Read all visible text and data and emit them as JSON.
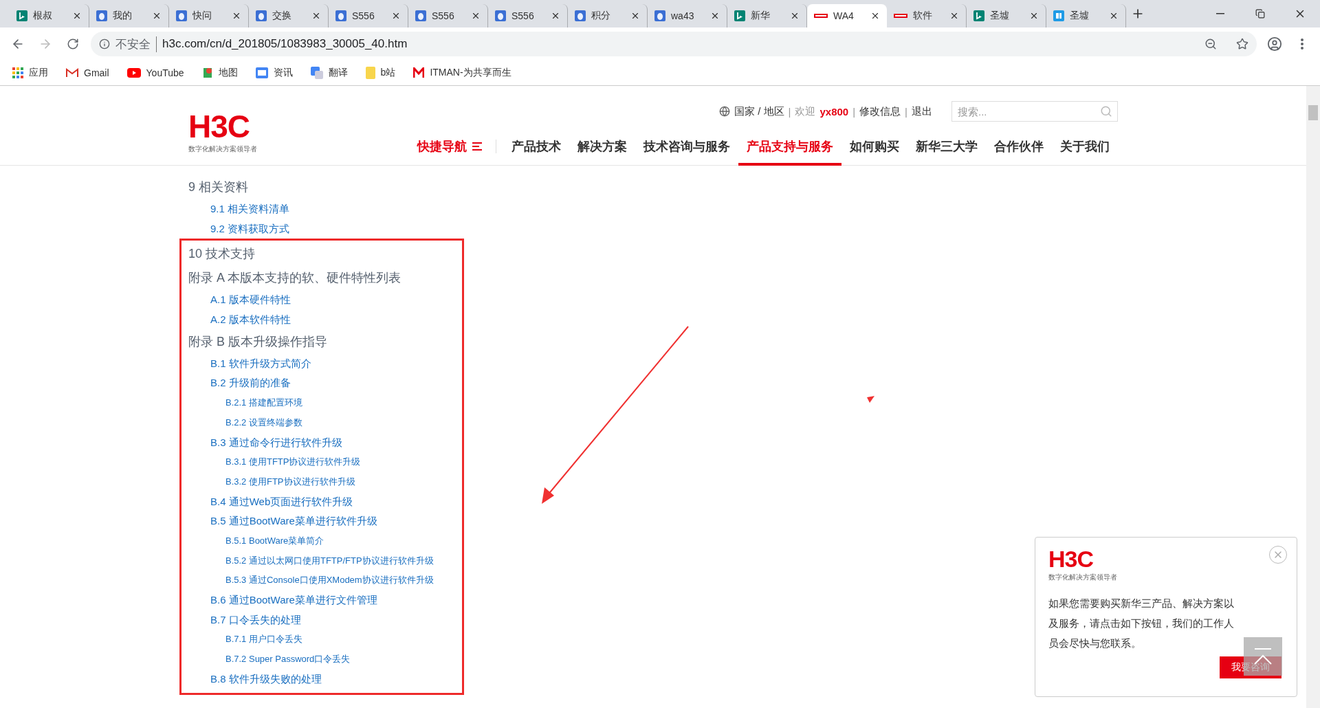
{
  "browser": {
    "tabs": [
      {
        "label": "根叔",
        "kind": "bing",
        "selected": false
      },
      {
        "label": "我的",
        "kind": "drop",
        "selected": false
      },
      {
        "label": "快问",
        "kind": "drop",
        "selected": false
      },
      {
        "label": "交换",
        "kind": "drop",
        "selected": false
      },
      {
        "label": "S556",
        "kind": "drop",
        "selected": false
      },
      {
        "label": "S556",
        "kind": "drop",
        "selected": false
      },
      {
        "label": "S556",
        "kind": "drop",
        "selected": false
      },
      {
        "label": "积分",
        "kind": "drop",
        "selected": false
      },
      {
        "label": "wa43",
        "kind": "drop",
        "selected": false
      },
      {
        "label": "新华",
        "kind": "bing",
        "selected": false
      },
      {
        "label": "WA4",
        "kind": "h3c",
        "selected": true
      },
      {
        "label": "软件",
        "kind": "h3c",
        "selected": false
      },
      {
        "label": "圣墟",
        "kind": "bing",
        "selected": false
      },
      {
        "label": "圣墟",
        "kind": "book",
        "selected": false
      }
    ],
    "forward_disabled": true,
    "security_label": "不安全",
    "url": "h3c.com/cn/d_201805/1083983_30005_40.htm",
    "bookmarks": [
      {
        "label": "应用",
        "kind": "apps"
      },
      {
        "label": "Gmail",
        "kind": "gmail"
      },
      {
        "label": "YouTube",
        "kind": "youtube"
      },
      {
        "label": "地图",
        "kind": "maps"
      },
      {
        "label": "资讯",
        "kind": "news"
      },
      {
        "label": "翻译",
        "kind": "translate"
      },
      {
        "label": "b站",
        "kind": "folder"
      },
      {
        "label": "ITMAN-为共享而生",
        "kind": "m"
      }
    ]
  },
  "header": {
    "logo": "H3C",
    "tagline": "数字化解决方案领导者",
    "top_links": [
      {
        "kind": "link",
        "label": "国家 / 地区"
      },
      {
        "kind": "separator",
        "label": "|"
      },
      {
        "kind": "text",
        "label": "欢迎"
      },
      {
        "kind": "user",
        "label": "yx800"
      },
      {
        "kind": "separator",
        "label": "|"
      },
      {
        "kind": "link",
        "label": "修改信息"
      },
      {
        "kind": "separator",
        "label": "|"
      },
      {
        "kind": "link",
        "label": "退出"
      }
    ],
    "search": {
      "placeholder": "搜索..."
    },
    "quick_nav": "快捷导航",
    "nav": [
      {
        "label": "产品技术",
        "selected": false
      },
      {
        "label": "解决方案",
        "selected": false
      },
      {
        "label": "技术咨询与服务",
        "selected": false
      },
      {
        "label": "产品支持与服务",
        "selected": true
      },
      {
        "label": "如何购买",
        "selected": false
      },
      {
        "label": "新华三大学",
        "selected": false
      },
      {
        "label": "合作伙伴",
        "selected": false
      },
      {
        "label": "关于我们",
        "selected": false
      }
    ]
  },
  "toc": [
    {
      "label": "9 相关资料",
      "children": [
        {
          "label": "9.1 相关资料清单"
        },
        {
          "label": "9.2 资料获取方式"
        }
      ]
    }
  ],
  "highlighted_toc": [
    {
      "label": "10 技术支持"
    },
    {
      "label": "附录 A 本版本支持的软、硬件特性列表",
      "children": [
        {
          "label": "A.1 版本硬件特性"
        },
        {
          "label": "A.2 版本软件特性"
        }
      ]
    },
    {
      "label": "附录 B 版本升级操作指导",
      "children": [
        {
          "label": "B.1 软件升级方式简介"
        },
        {
          "label": "B.2 升级前的准备",
          "children": [
            {
              "label": "B.2.1 搭建配置环境"
            },
            {
              "label": "B.2.2 设置终端参数"
            }
          ]
        },
        {
          "label": "B.3 通过命令行进行软件升级",
          "children": [
            {
              "label": "B.3.1 使用TFTP协议进行软件升级"
            },
            {
              "label": "B.3.2 使用FTP协议进行软件升级"
            }
          ]
        },
        {
          "label": "B.4 通过Web页面进行软件升级"
        },
        {
          "label": "B.5 通过BootWare菜单进行软件升级",
          "children": [
            {
              "label": "B.5.1 BootWare菜单简介"
            },
            {
              "label": "B.5.2 通过以太网口使用TFTP/FTP协议进行软件升级"
            },
            {
              "label": "B.5.3 通过Console口使用XModem协议进行软件升级"
            }
          ]
        },
        {
          "label": "B.6 通过BootWare菜单进行文件管理"
        },
        {
          "label": "B.7 口令丢失的处理",
          "children": [
            {
              "label": "B.7.1 用户口令丢失"
            },
            {
              "label": "B.7.2 Super Password口令丢失"
            }
          ]
        },
        {
          "label": "B.8 软件升级失败的处理"
        }
      ]
    }
  ],
  "popup": {
    "logo": "H3C",
    "tagline": "数字化解决方案领导者",
    "message": "如果您需要购买新华三产品、解决方案以及服务，请点击如下按钮，我们的工作人员会尽快与您联系。",
    "button": "我要咨询"
  }
}
